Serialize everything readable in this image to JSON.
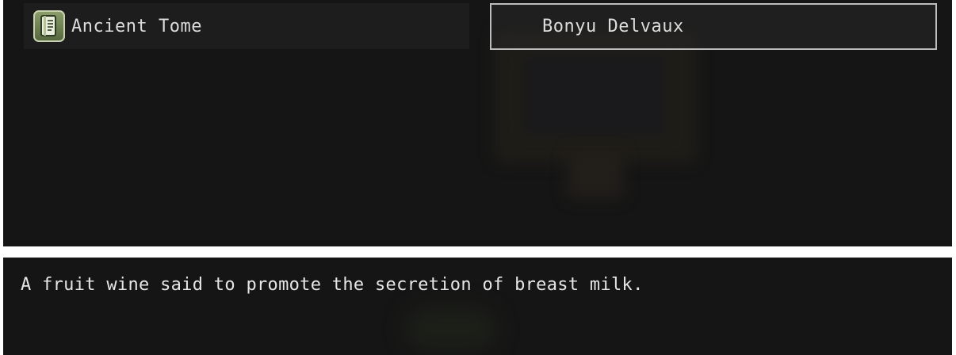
{
  "item_list": {
    "items": [
      {
        "label": "Ancient Tome",
        "icon": "book-icon"
      }
    ]
  },
  "target": {
    "name": "Bonyu Delvaux"
  },
  "description": {
    "text": "A fruit wine said to promote the secretion of breast milk."
  },
  "colors": {
    "window_bg": "#151515",
    "row_bg": "#1d1d1d",
    "text": "#dcdcdc",
    "icon_green": "#6f8550",
    "border": "#bdbdbd"
  }
}
